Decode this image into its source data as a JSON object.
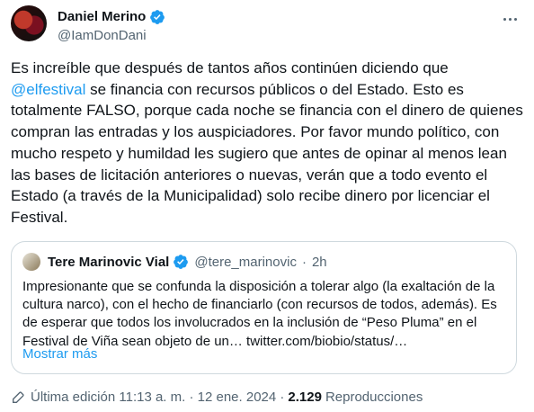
{
  "author": {
    "name": "Daniel Merino",
    "handle": "@IamDonDani"
  },
  "tweet": {
    "text_before": "Es increíble que después de tantos años continúen diciendo que ",
    "mention": "@elfestival",
    "text_after": " se financia con recursos públicos o del Estado. Esto es totalmente FALSO, porque cada noche se financia con el dinero de quienes compran las entradas y los auspiciadores. Por favor mundo político, con mucho respeto y humildad les sugiero que antes de opinar al menos lean las bases de licitación anteriores o nuevas, verán que a todo evento el Estado (a través de la Municipalidad) solo recibe dinero por licenciar el Festival."
  },
  "quote": {
    "name": "Tere Marinovic Vial",
    "handle": "@tere_marinovic",
    "separator": "·",
    "time": "2h",
    "text": "Impresionante que se confunda la disposición a tolerar algo (la exaltación de la cultura narco), con el hecho de financiarlo (con recursos de todos, además). Es de esperar que todos los involucrados en la inclusión de “Peso Pluma” en el Festival de Viña sean objeto de un… twitter.com/biobio/status/…",
    "show_more": "Mostrar más"
  },
  "footer": {
    "edited": "Última edición 11:13 a. m. · 12 ene. 2024 ·",
    "views_count": "2.129",
    "views_label": "Reproducciones"
  },
  "colors": {
    "link": "#1d9bf0",
    "secondary": "#536471",
    "verified": "#1d9bf0"
  }
}
